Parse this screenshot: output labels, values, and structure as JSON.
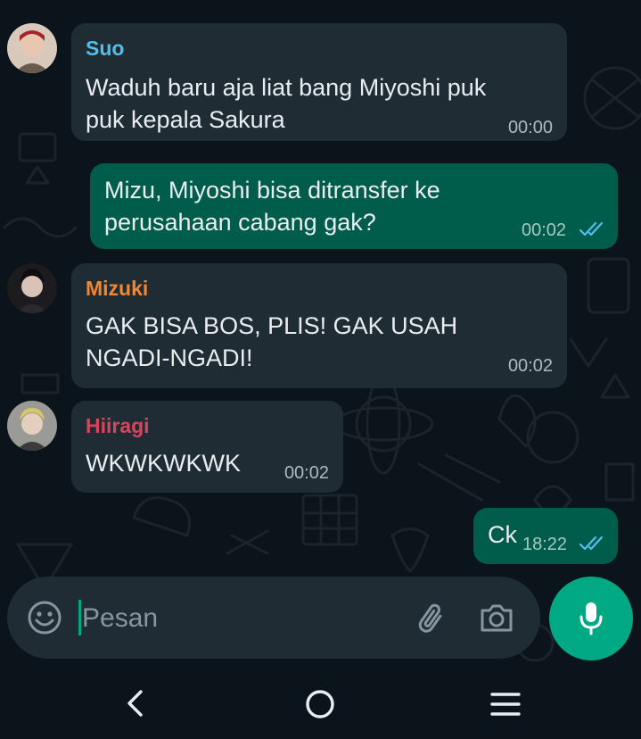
{
  "messages": [
    {
      "sender": "Suo",
      "sender_color": "#53bdeb",
      "text": "Waduh baru aja liat bang Miyoshi puk\npuk kepala Sakura",
      "time": "00:00",
      "direction": "incoming"
    },
    {
      "text": "Mizu, Miyoshi bisa ditransfer ke\nperusahaan cabang gak?",
      "time": "00:02",
      "direction": "outgoing",
      "status": "read"
    },
    {
      "sender": "Mizuki",
      "sender_color": "#f3862f",
      "text": "GAK BISA BOS, PLIS! GAK USAH\nNGADI-NGADI!",
      "time": "00:02",
      "direction": "incoming"
    },
    {
      "sender": "Hiiragi",
      "sender_color": "#d6455d",
      "text": "WKWKWKWK",
      "time": "00:02",
      "direction": "incoming"
    },
    {
      "text": "Ck",
      "time": "18:22",
      "direction": "outgoing",
      "status": "read"
    }
  ],
  "composer": {
    "placeholder": "Pesan",
    "emoji_icon": "emoji-icon",
    "attach_icon": "paperclip-icon",
    "camera_icon": "camera-icon",
    "mic_icon": "mic-icon"
  },
  "navbar": {
    "back_icon": "back-icon",
    "home_icon": "home-icon",
    "recents_icon": "menu-icon"
  },
  "colors": {
    "background": "#0b141a",
    "incoming_bubble": "#1f2c33",
    "outgoing_bubble": "#005c4b",
    "accent": "#00a884",
    "read_ticks": "#53bdeb"
  }
}
